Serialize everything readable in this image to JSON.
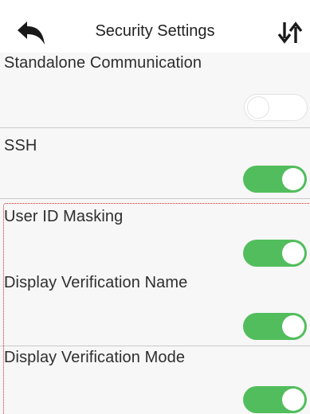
{
  "header": {
    "title": "Security Settings",
    "back_icon": "back-arrow-icon",
    "sort_icon": "sort-arrows-icon"
  },
  "settings": [
    {
      "label": "Standalone Communication",
      "enabled": false
    },
    {
      "label": "SSH",
      "enabled": true
    },
    {
      "label": "User ID Masking",
      "enabled": true
    },
    {
      "label": "Display Verification Name",
      "enabled": true
    },
    {
      "label": "Display Verification Mode",
      "enabled": true
    }
  ],
  "colors": {
    "toggle_on": "#52bd5d",
    "highlight_border": "#d8262a"
  }
}
